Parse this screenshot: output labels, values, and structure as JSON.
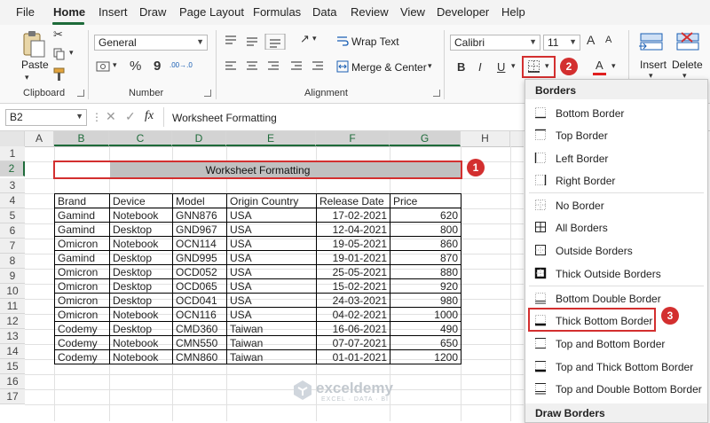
{
  "menu": {
    "items": [
      "File",
      "Home",
      "Insert",
      "Draw",
      "Page Layout",
      "Formulas",
      "Data",
      "Review",
      "View",
      "Developer",
      "Help"
    ]
  },
  "ribbon": {
    "clipboard": {
      "paste_label": "Paste",
      "group_label": "Clipboard"
    },
    "number": {
      "format_value": "General",
      "percent": "%",
      "comma": "9",
      "inc_decimal": ".00→.0",
      "group_label": "Number"
    },
    "alignment": {
      "wrap_text": "Wrap Text",
      "merge_center": "Merge & Center",
      "group_label": "Alignment"
    },
    "font": {
      "font_name": "Calibri",
      "font_size": "11",
      "bold": "B",
      "italic": "I",
      "underline": "U",
      "font_color": "A",
      "grow": "A",
      "shrink": "A"
    },
    "cells": {
      "insert_label": "Insert",
      "delete_label": "Delete"
    }
  },
  "formula_bar": {
    "name_box": "B2",
    "fx": "fx",
    "content": "Worksheet Formatting"
  },
  "sheet": {
    "columns": [
      "A",
      "B",
      "C",
      "D",
      "E",
      "F",
      "G",
      "H"
    ],
    "rows": [
      "1",
      "2",
      "3",
      "4",
      "5",
      "6",
      "7",
      "8",
      "9",
      "10",
      "11",
      "12",
      "13",
      "14",
      "15",
      "16",
      "17"
    ],
    "title": "Worksheet Formatting",
    "headers": [
      "Brand",
      "Device",
      "Model",
      "Origin Country",
      "Release Date",
      "Price"
    ],
    "data": [
      [
        "Gamind",
        "Notebook",
        "GNN876",
        "USA",
        "17-02-2021",
        "620"
      ],
      [
        "Gamind",
        "Desktop",
        "GND967",
        "USA",
        "12-04-2021",
        "800"
      ],
      [
        "Omicron",
        "Notebook",
        "OCN114",
        "USA",
        "19-05-2021",
        "860"
      ],
      [
        "Gamind",
        "Desktop",
        "GND995",
        "USA",
        "19-01-2021",
        "870"
      ],
      [
        "Omicron",
        "Desktop",
        "OCD052",
        "USA",
        "25-05-2021",
        "880"
      ],
      [
        "Omicron",
        "Desktop",
        "OCD065",
        "USA",
        "15-02-2021",
        "920"
      ],
      [
        "Omicron",
        "Desktop",
        "OCD041",
        "USA",
        "24-03-2021",
        "980"
      ],
      [
        "Omicron",
        "Notebook",
        "OCN116",
        "USA",
        "04-02-2021",
        "1000"
      ],
      [
        "Codemy",
        "Desktop",
        "CMD360",
        "Taiwan",
        "16-06-2021",
        "490"
      ],
      [
        "Codemy",
        "Notebook",
        "CMN550",
        "Taiwan",
        "07-07-2021",
        "650"
      ],
      [
        "Codemy",
        "Notebook",
        "CMN860",
        "Taiwan",
        "01-01-2021",
        "1200"
      ]
    ]
  },
  "borders_menu": {
    "header": "Borders",
    "items": [
      "Bottom Border",
      "Top Border",
      "Left Border",
      "Right Border",
      "No Border",
      "All Borders",
      "Outside Borders",
      "Thick Outside Borders",
      "Bottom Double Border",
      "Thick Bottom Border",
      "Top and Bottom Border",
      "Top and Thick Bottom Border",
      "Top and Double Bottom Border"
    ],
    "footer": "Draw Borders"
  },
  "callouts": [
    "1",
    "2",
    "3"
  ],
  "watermark": {
    "name": "exceldemy",
    "tagline": "EXCEL · DATA · BI"
  },
  "colors": {
    "accent": "#1e6b3a",
    "callout": "#d32f2f",
    "title_fill": "#c0c0c0"
  }
}
